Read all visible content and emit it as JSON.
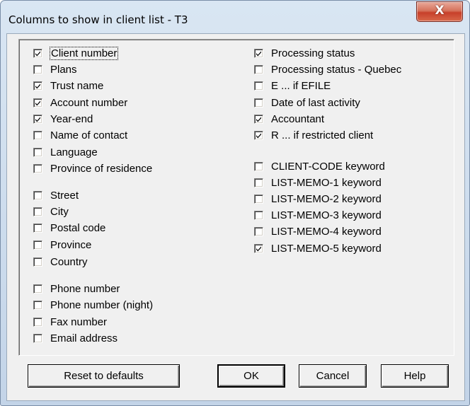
{
  "window": {
    "title": "Columns to show in client list - T3",
    "close_glyph": "X"
  },
  "left_column": [
    {
      "label": "Client number",
      "checked": true
    },
    {
      "label": "Plans",
      "checked": false
    },
    {
      "label": "Trust name",
      "checked": true
    },
    {
      "label": "Account number",
      "checked": true
    },
    {
      "label": "Year-end",
      "checked": true
    },
    {
      "label": "Name of contact",
      "checked": false
    },
    {
      "label": "Language",
      "checked": false
    },
    {
      "label": "Province of residence",
      "checked": false
    },
    {
      "label": "Street",
      "checked": false
    },
    {
      "label": "City",
      "checked": false
    },
    {
      "label": "Postal code",
      "checked": false
    },
    {
      "label": "Province",
      "checked": false
    },
    {
      "label": "Country",
      "checked": false
    },
    {
      "label": "Phone number",
      "checked": false
    },
    {
      "label": "Phone number (night)",
      "checked": false
    },
    {
      "label": "Fax number",
      "checked": false
    },
    {
      "label": "Email address",
      "checked": false
    }
  ],
  "right_column": [
    {
      "label": "Processing status",
      "checked": true
    },
    {
      "label": "Processing status - Quebec",
      "checked": false
    },
    {
      "label": "E ... if EFILE",
      "checked": false
    },
    {
      "label": "Date of last activity",
      "checked": false
    },
    {
      "label": "Accountant",
      "checked": true
    },
    {
      "label": "R ... if restricted client",
      "checked": true
    },
    {
      "label": "CLIENT-CODE keyword",
      "checked": false
    },
    {
      "label": "LIST-MEMO-1 keyword",
      "checked": false
    },
    {
      "label": "LIST-MEMO-2 keyword",
      "checked": false
    },
    {
      "label": "LIST-MEMO-3 keyword",
      "checked": false
    },
    {
      "label": "LIST-MEMO-4 keyword",
      "checked": false
    },
    {
      "label": "LIST-MEMO-5 keyword",
      "checked": true
    }
  ],
  "buttons": {
    "reset": "Reset to defaults",
    "ok": "OK",
    "cancel": "Cancel",
    "help": "Help"
  }
}
